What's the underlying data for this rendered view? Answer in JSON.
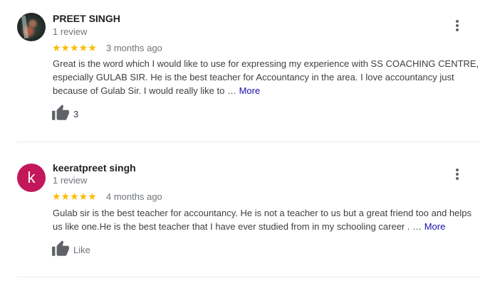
{
  "reviews": [
    {
      "reviewer": "PREET SINGH",
      "review_count": "1 review",
      "rating": 5,
      "stars": "★★★★★",
      "time": "3 months ago",
      "text": "Great is the word which I would like to use for expressing my experience with SS COACHING CENTRE, especially GULAB SIR. He is the best teacher for Accountancy in the area. I love accountancy just because of Gulab Sir. I would really like to … ",
      "more_label": "More",
      "likes": "3"
    },
    {
      "reviewer": "keeratpreet singh",
      "avatar_letter": "k",
      "avatar_color": "#c2185b",
      "review_count": "1 review",
      "rating": 5,
      "stars": "★★★★★",
      "time": "4 months ago",
      "text": "Gulab sir is the best teacher for accountancy. He is not a teacher to us but a great friend too and helps us like one.He is the best teacher that I have ever studied from in my schooling career . … ",
      "more_label": "More",
      "likes": "Like"
    }
  ],
  "colors": {
    "star": "#fbbc04",
    "link": "#1a0dab",
    "secondary_text": "#70757a"
  },
  "icons": {
    "menu": "more-vert-icon",
    "like": "thumbs-up-icon"
  }
}
